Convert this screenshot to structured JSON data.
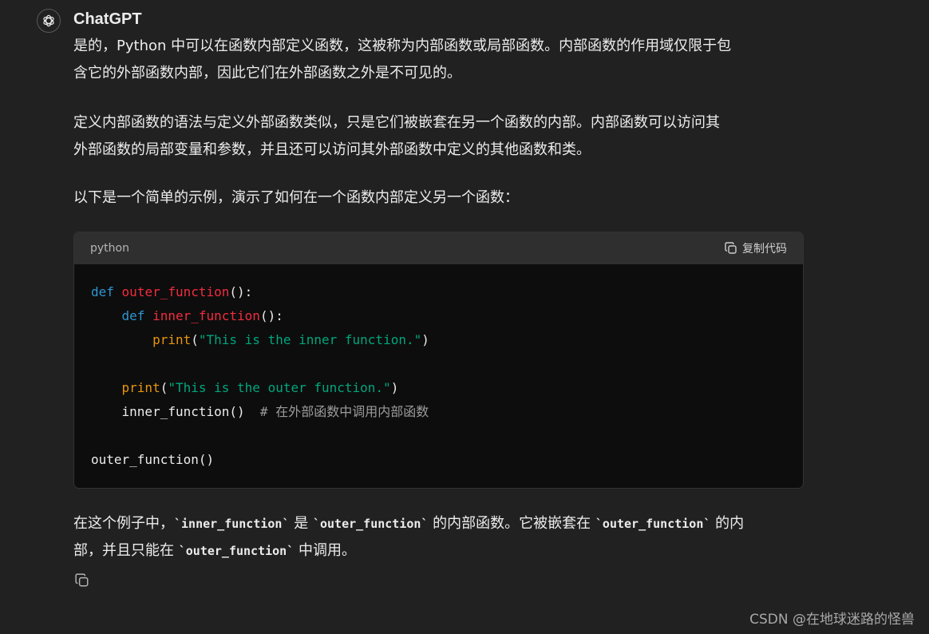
{
  "message": {
    "sender": "ChatGPT",
    "avatar_icon": "openai-logo-icon",
    "paragraphs": {
      "p1_line1": "是的，Python 中可以在函数内部定义函数，这被称为内部函数或局部函数。内部函数的作用域仅限于包",
      "p1_line2": "含它的外部函数内部，因此它们在外部函数之外是不可见的。",
      "p2_line1": "定义内部函数的语法与定义外部函数类似，只是它们被嵌套在另一个函数的内部。内部函数可以访问其",
      "p2_line2": "外部函数的局部变量和参数，并且还可以访问其外部函数中定义的其他函数和类。",
      "p3": "以下是一个简单的示例，演示了如何在一个函数内部定义另一个函数："
    },
    "code": {
      "language": "python",
      "copy_label": "复制代码",
      "copy_icon": "copy-icon",
      "tokens": {
        "def1": "def",
        "outer_name": "outer_function",
        "paren_colon1": "():",
        "def2": "def",
        "inner_name": "inner_function",
        "paren_colon2": "():",
        "print1": "print",
        "open1": "(",
        "str1": "\"This is the inner function.\"",
        "close1": ")",
        "print2": "print",
        "open2": "(",
        "str2": "\"This is the outer function.\"",
        "close2": ")",
        "inner_call": "inner_function()",
        "comment": "# 在外部函数中调用内部函数",
        "outer_call": "outer_function()"
      }
    },
    "closing": {
      "t1": "在这个例子中，",
      "c1": "`inner_function`",
      "t2": " 是 ",
      "c2": "`outer_function`",
      "t3": " 的内部函数。它被嵌套在 ",
      "c3": "`outer_function`",
      "t4": " 的内",
      "t5": "部，并且只能在 ",
      "c4": "`outer_function`",
      "t6": " 中调用。"
    },
    "message_copy_icon": "copy-icon"
  },
  "watermark": "CSDN @在地球迷路的怪兽",
  "colors": {
    "background": "#212121",
    "code_bg": "#0d0d0d",
    "code_header": "#2f2f2f",
    "keyword": "#2e95d3",
    "function_name": "#f22c3d",
    "builtin": "#e9950c",
    "string": "#00a67d",
    "comment": "#9b9b9b"
  }
}
